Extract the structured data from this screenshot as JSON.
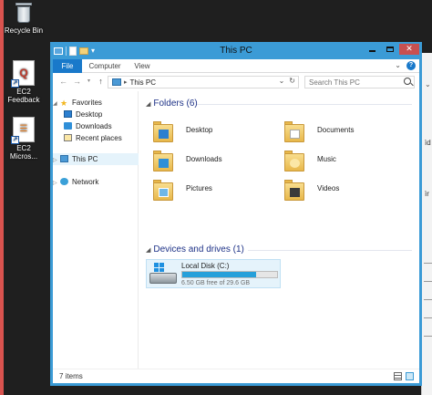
{
  "desktop": {
    "icons": [
      {
        "label": "Recycle Bin"
      },
      {
        "label": "EC2\nFeedback"
      },
      {
        "label": "EC2\nMicros..."
      }
    ]
  },
  "window": {
    "title": "This PC",
    "controls": {
      "minimize": "",
      "maximize": "",
      "close": "✕"
    }
  },
  "ribbon": {
    "tabs": [
      {
        "label": "File"
      },
      {
        "label": "Computer"
      },
      {
        "label": "View"
      }
    ],
    "expand": "⌄",
    "help": "?"
  },
  "address_bar": {
    "back": "←",
    "forward": "→",
    "recent": "▾",
    "up": "↑",
    "separator": "▸",
    "path": "This PC",
    "dropdown": "⌄",
    "refresh": "↻",
    "search_placeholder": "Search This PC"
  },
  "nav_pane": {
    "favorites": {
      "label": "Favorites",
      "items": [
        {
          "label": "Desktop"
        },
        {
          "label": "Downloads"
        },
        {
          "label": "Recent places"
        }
      ]
    },
    "this_pc": {
      "label": "This PC"
    },
    "network": {
      "label": "Network"
    }
  },
  "content": {
    "folders_header": "Folders (6)",
    "folders": [
      {
        "name": "Desktop"
      },
      {
        "name": "Documents"
      },
      {
        "name": "Downloads"
      },
      {
        "name": "Music"
      },
      {
        "name": "Pictures"
      },
      {
        "name": "Videos"
      }
    ],
    "devices_header": "Devices and drives (1)",
    "drive": {
      "name": "Local Disk (C:)",
      "free_text": "6.50 GB free of 29.6 GB",
      "used_fraction": 0.78
    }
  },
  "status": {
    "item_count": "7 items"
  },
  "colors": {
    "window_frame": "#3b9bd6",
    "file_tab": "#1979ca",
    "close_button": "#c75050",
    "drive_bar": "#26a0da",
    "group_header": "#1e3287"
  },
  "background_snippets": [
    {
      "text": "ìd"
    },
    {
      "text": "ìr"
    }
  ]
}
